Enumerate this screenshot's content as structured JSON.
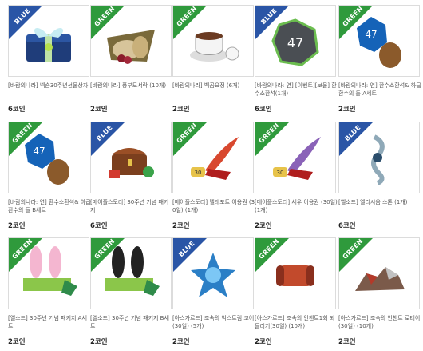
{
  "items": [
    {
      "badge": "BLUE",
      "title": "[바람의나라] 넥슨30주년선물상자",
      "price": "6코인",
      "icon": "gift-box-icon"
    },
    {
      "badge": "GREEN",
      "title": "[바람의나라] 풍부도서락 (10개)",
      "price": "2코인",
      "icon": "food-bundle-icon"
    },
    {
      "badge": "GREEN",
      "title": "[바람의나라] 백곰요정 (6개)",
      "price": "2코인",
      "icon": "coffee-cup-icon"
    },
    {
      "badge": "BLUE",
      "title": "[바람의나라: 연] [이벤트][보물] 환수소환석(1개)",
      "price": "6코인",
      "icon": "summon-stone-icon"
    },
    {
      "badge": "GREEN",
      "title": "[바람의나라: 연] 환수소환석& 하급 환수의 돌 A세트",
      "price": "2코인",
      "icon": "stone-set-a-icon"
    },
    {
      "badge": "GREEN",
      "title": "[바람의나라: 연] 환수소환석& 하급 환수의 돌 B세트",
      "price": "2코인",
      "icon": "stone-set-b-icon"
    },
    {
      "badge": "BLUE",
      "title": "[메이플스토리] 30주년 기념 패키지",
      "price": "6코인",
      "icon": "treasure-chest-icon"
    },
    {
      "badge": "GREEN",
      "title": "[메이플스토리] 텔레포트 이용권 (30일) (1개)",
      "price": "2코인",
      "icon": "red-feather-icon"
    },
    {
      "badge": "GREEN",
      "title": "[메이플스토리] 세우 이용권 (30일) (1개)",
      "price": "2코인",
      "icon": "purple-feather-icon"
    },
    {
      "badge": "BLUE",
      "title": "[엘소드] 엘리시움 스톤 (1개)",
      "price": "6코인",
      "icon": "charm-icon"
    },
    {
      "badge": "GREEN",
      "title": "[엘소드] 30주년 기념 패키지 A세트",
      "price": "2코인",
      "icon": "pink-ears-icon"
    },
    {
      "badge": "GREEN",
      "title": "[엘소드] 30주년 기념 패키지 B세트",
      "price": "2코인",
      "icon": "black-ears-icon"
    },
    {
      "badge": "BLUE",
      "title": "[아스가르드] 조속의 익스트림 코어(30일) (5개)",
      "price": "2코인",
      "icon": "star-crystal-icon"
    },
    {
      "badge": "GREEN",
      "title": "[아스가르드] 조속의 인챈트1회 되돌리기(30일) (10개)",
      "price": "2코인",
      "icon": "scroll-red-icon"
    },
    {
      "badge": "GREEN",
      "title": "[아스가르드] 조속의 인챈트 로테이(30일) (10개)",
      "price": "2코인",
      "icon": "ore-pile-icon"
    }
  ],
  "colors": {
    "green": "#2f9a3c",
    "blue": "#2a55a6"
  }
}
